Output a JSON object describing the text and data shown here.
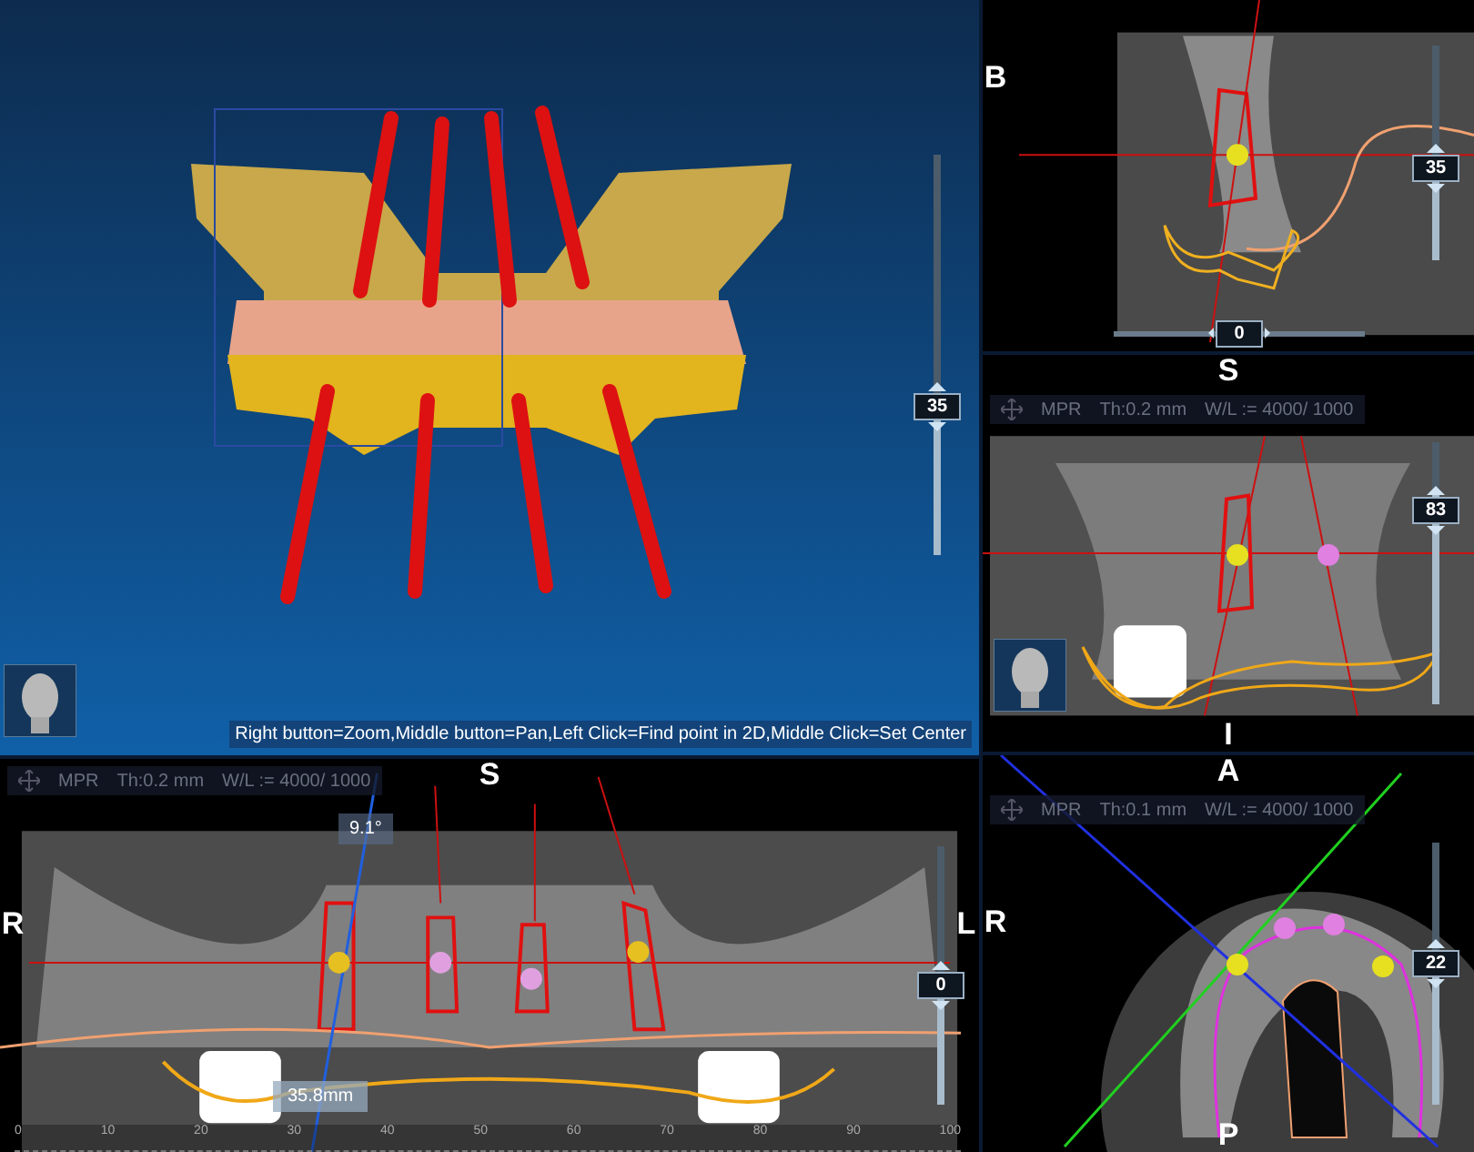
{
  "left_column": [
    {
      "kind": "volume",
      "face_icon": true,
      "hint": "Right button=Zoom,Middle button=Pan,Left Click=Find point in 2D,Middle Click=Set Center",
      "slider": {
        "value": "35",
        "level": 0.35
      }
    },
    {
      "kind": "coronal",
      "info": {
        "mode": "MPR",
        "thickness": "Th:0.2 mm",
        "wl": "W/L := 4000/ 1000"
      },
      "letters": {
        "top": "S",
        "left": "R",
        "right": "L"
      },
      "slider": {
        "value": "0",
        "level": 0.45
      },
      "angle": "9.1°",
      "measurement": "35.8mm",
      "ruler": [
        "0",
        "10",
        "20",
        "30",
        "40",
        "50",
        "60",
        "70",
        "80",
        "90",
        "100"
      ]
    }
  ],
  "right_column": [
    {
      "kind": "sagittal",
      "letters": {
        "left": "B"
      },
      "slider": {
        "value": "35",
        "level": 0.4
      },
      "hslider": {
        "value": "0",
        "level": 0.5
      }
    },
    {
      "kind": "cross",
      "face_icon": true,
      "info": {
        "mode": "MPR",
        "thickness": "Th:0.2 mm",
        "wl": "W/L := 4000/ 1000"
      },
      "letters": {
        "top": "S",
        "bottom": "I"
      },
      "slider": {
        "value": "83",
        "level": 0.8
      }
    },
    {
      "kind": "axial",
      "info": {
        "mode": "MPR",
        "thickness": "Th:0.1 mm",
        "wl": "W/L := 4000/ 1000"
      },
      "letters": {
        "top": "A",
        "bottom": "P",
        "left": "R"
      },
      "slider": {
        "value": "22",
        "level": 0.55
      }
    }
  ]
}
